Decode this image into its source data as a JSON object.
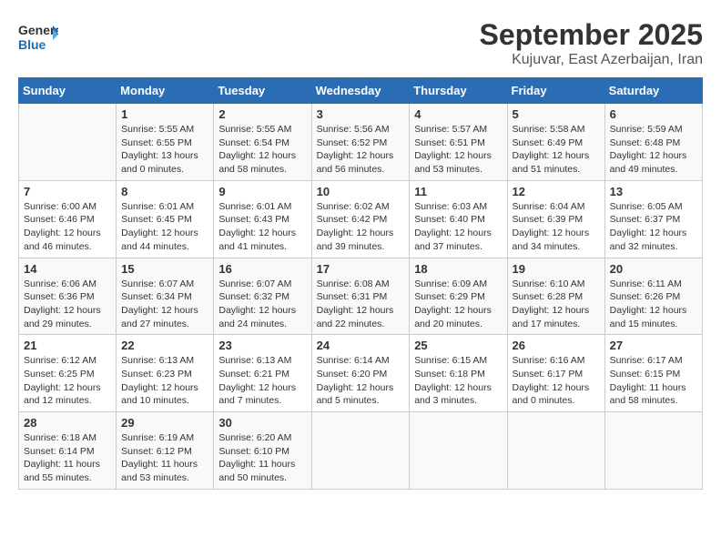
{
  "header": {
    "logo_general": "General",
    "logo_blue": "Blue",
    "month": "September 2025",
    "location": "Kujuvar, East Azerbaijan, Iran"
  },
  "weekdays": [
    "Sunday",
    "Monday",
    "Tuesday",
    "Wednesday",
    "Thursday",
    "Friday",
    "Saturday"
  ],
  "weeks": [
    [
      {
        "day": "",
        "info": ""
      },
      {
        "day": "1",
        "info": "Sunrise: 5:55 AM\nSunset: 6:55 PM\nDaylight: 13 hours\nand 0 minutes."
      },
      {
        "day": "2",
        "info": "Sunrise: 5:55 AM\nSunset: 6:54 PM\nDaylight: 12 hours\nand 58 minutes."
      },
      {
        "day": "3",
        "info": "Sunrise: 5:56 AM\nSunset: 6:52 PM\nDaylight: 12 hours\nand 56 minutes."
      },
      {
        "day": "4",
        "info": "Sunrise: 5:57 AM\nSunset: 6:51 PM\nDaylight: 12 hours\nand 53 minutes."
      },
      {
        "day": "5",
        "info": "Sunrise: 5:58 AM\nSunset: 6:49 PM\nDaylight: 12 hours\nand 51 minutes."
      },
      {
        "day": "6",
        "info": "Sunrise: 5:59 AM\nSunset: 6:48 PM\nDaylight: 12 hours\nand 49 minutes."
      }
    ],
    [
      {
        "day": "7",
        "info": "Sunrise: 6:00 AM\nSunset: 6:46 PM\nDaylight: 12 hours\nand 46 minutes."
      },
      {
        "day": "8",
        "info": "Sunrise: 6:01 AM\nSunset: 6:45 PM\nDaylight: 12 hours\nand 44 minutes."
      },
      {
        "day": "9",
        "info": "Sunrise: 6:01 AM\nSunset: 6:43 PM\nDaylight: 12 hours\nand 41 minutes."
      },
      {
        "day": "10",
        "info": "Sunrise: 6:02 AM\nSunset: 6:42 PM\nDaylight: 12 hours\nand 39 minutes."
      },
      {
        "day": "11",
        "info": "Sunrise: 6:03 AM\nSunset: 6:40 PM\nDaylight: 12 hours\nand 37 minutes."
      },
      {
        "day": "12",
        "info": "Sunrise: 6:04 AM\nSunset: 6:39 PM\nDaylight: 12 hours\nand 34 minutes."
      },
      {
        "day": "13",
        "info": "Sunrise: 6:05 AM\nSunset: 6:37 PM\nDaylight: 12 hours\nand 32 minutes."
      }
    ],
    [
      {
        "day": "14",
        "info": "Sunrise: 6:06 AM\nSunset: 6:36 PM\nDaylight: 12 hours\nand 29 minutes."
      },
      {
        "day": "15",
        "info": "Sunrise: 6:07 AM\nSunset: 6:34 PM\nDaylight: 12 hours\nand 27 minutes."
      },
      {
        "day": "16",
        "info": "Sunrise: 6:07 AM\nSunset: 6:32 PM\nDaylight: 12 hours\nand 24 minutes."
      },
      {
        "day": "17",
        "info": "Sunrise: 6:08 AM\nSunset: 6:31 PM\nDaylight: 12 hours\nand 22 minutes."
      },
      {
        "day": "18",
        "info": "Sunrise: 6:09 AM\nSunset: 6:29 PM\nDaylight: 12 hours\nand 20 minutes."
      },
      {
        "day": "19",
        "info": "Sunrise: 6:10 AM\nSunset: 6:28 PM\nDaylight: 12 hours\nand 17 minutes."
      },
      {
        "day": "20",
        "info": "Sunrise: 6:11 AM\nSunset: 6:26 PM\nDaylight: 12 hours\nand 15 minutes."
      }
    ],
    [
      {
        "day": "21",
        "info": "Sunrise: 6:12 AM\nSunset: 6:25 PM\nDaylight: 12 hours\nand 12 minutes."
      },
      {
        "day": "22",
        "info": "Sunrise: 6:13 AM\nSunset: 6:23 PM\nDaylight: 12 hours\nand 10 minutes."
      },
      {
        "day": "23",
        "info": "Sunrise: 6:13 AM\nSunset: 6:21 PM\nDaylight: 12 hours\nand 7 minutes."
      },
      {
        "day": "24",
        "info": "Sunrise: 6:14 AM\nSunset: 6:20 PM\nDaylight: 12 hours\nand 5 minutes."
      },
      {
        "day": "25",
        "info": "Sunrise: 6:15 AM\nSunset: 6:18 PM\nDaylight: 12 hours\nand 3 minutes."
      },
      {
        "day": "26",
        "info": "Sunrise: 6:16 AM\nSunset: 6:17 PM\nDaylight: 12 hours\nand 0 minutes."
      },
      {
        "day": "27",
        "info": "Sunrise: 6:17 AM\nSunset: 6:15 PM\nDaylight: 11 hours\nand 58 minutes."
      }
    ],
    [
      {
        "day": "28",
        "info": "Sunrise: 6:18 AM\nSunset: 6:14 PM\nDaylight: 11 hours\nand 55 minutes."
      },
      {
        "day": "29",
        "info": "Sunrise: 6:19 AM\nSunset: 6:12 PM\nDaylight: 11 hours\nand 53 minutes."
      },
      {
        "day": "30",
        "info": "Sunrise: 6:20 AM\nSunset: 6:10 PM\nDaylight: 11 hours\nand 50 minutes."
      },
      {
        "day": "",
        "info": ""
      },
      {
        "day": "",
        "info": ""
      },
      {
        "day": "",
        "info": ""
      },
      {
        "day": "",
        "info": ""
      }
    ]
  ]
}
